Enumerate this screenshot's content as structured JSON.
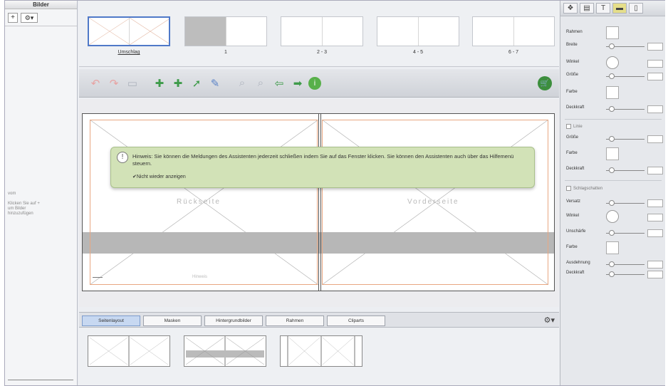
{
  "left_panel": {
    "title": "Bilder",
    "add": "+",
    "gear": "⚙▾",
    "small1": "vom",
    "small2": "Klicken Sie auf +",
    "small3": "um Bilder",
    "small4": "hinzuzufügen"
  },
  "thumbnails": [
    {
      "label": "Umschlag"
    },
    {
      "label": "1"
    },
    {
      "label": "2 - 3"
    },
    {
      "label": "4 - 5"
    },
    {
      "label": "6 - 7"
    }
  ],
  "toolbar": {
    "cart_icon": "cart-icon"
  },
  "canvas": {
    "left_page_label": "Rückseite",
    "right_page_label": "Vorderseite",
    "small_label": "Hinweis"
  },
  "notification": {
    "icon": "!",
    "text": "Hinweis: Sie können die Meldungen des Assistenten jederzeit schließen indem Sie auf das Fenster klicken. Sie können den Assistenten auch über das Hilfemenü steuern.",
    "checkbox_label": "✔Nicht wieder anzeigen"
  },
  "bottom_tabs": [
    "Seitenlayout",
    "Masken",
    "Hintergrundbilder",
    "Rahmen",
    "Cliparts"
  ],
  "right_panel": {
    "rows_top": [
      {
        "label": "Rahmen",
        "type": "swatch"
      },
      {
        "label": "Breite",
        "type": "slider"
      },
      {
        "label": "Winkel",
        "type": "dial"
      },
      {
        "label": "Größe",
        "type": "slider"
      },
      {
        "label": "Farbe",
        "type": "swatch"
      },
      {
        "label": "Deckkraft",
        "type": "slider"
      }
    ],
    "section_line": "Linie",
    "rows_mid": [
      {
        "label": "Größe",
        "type": "slider"
      },
      {
        "label": "Farbe",
        "type": "swatch"
      },
      {
        "label": "Deckkraft",
        "type": "slider"
      }
    ],
    "section_shadow": "Schlagschatten",
    "rows_bottom": [
      {
        "label": "Versatz",
        "type": "slider"
      },
      {
        "label": "Winkel",
        "type": "dial"
      },
      {
        "label": "Unschärfe",
        "type": "slider"
      },
      {
        "label": "Farbe",
        "type": "swatch"
      },
      {
        "label": "Ausdehnung",
        "type": "slider"
      },
      {
        "label": "Deckkraft",
        "type": "slider"
      }
    ]
  }
}
